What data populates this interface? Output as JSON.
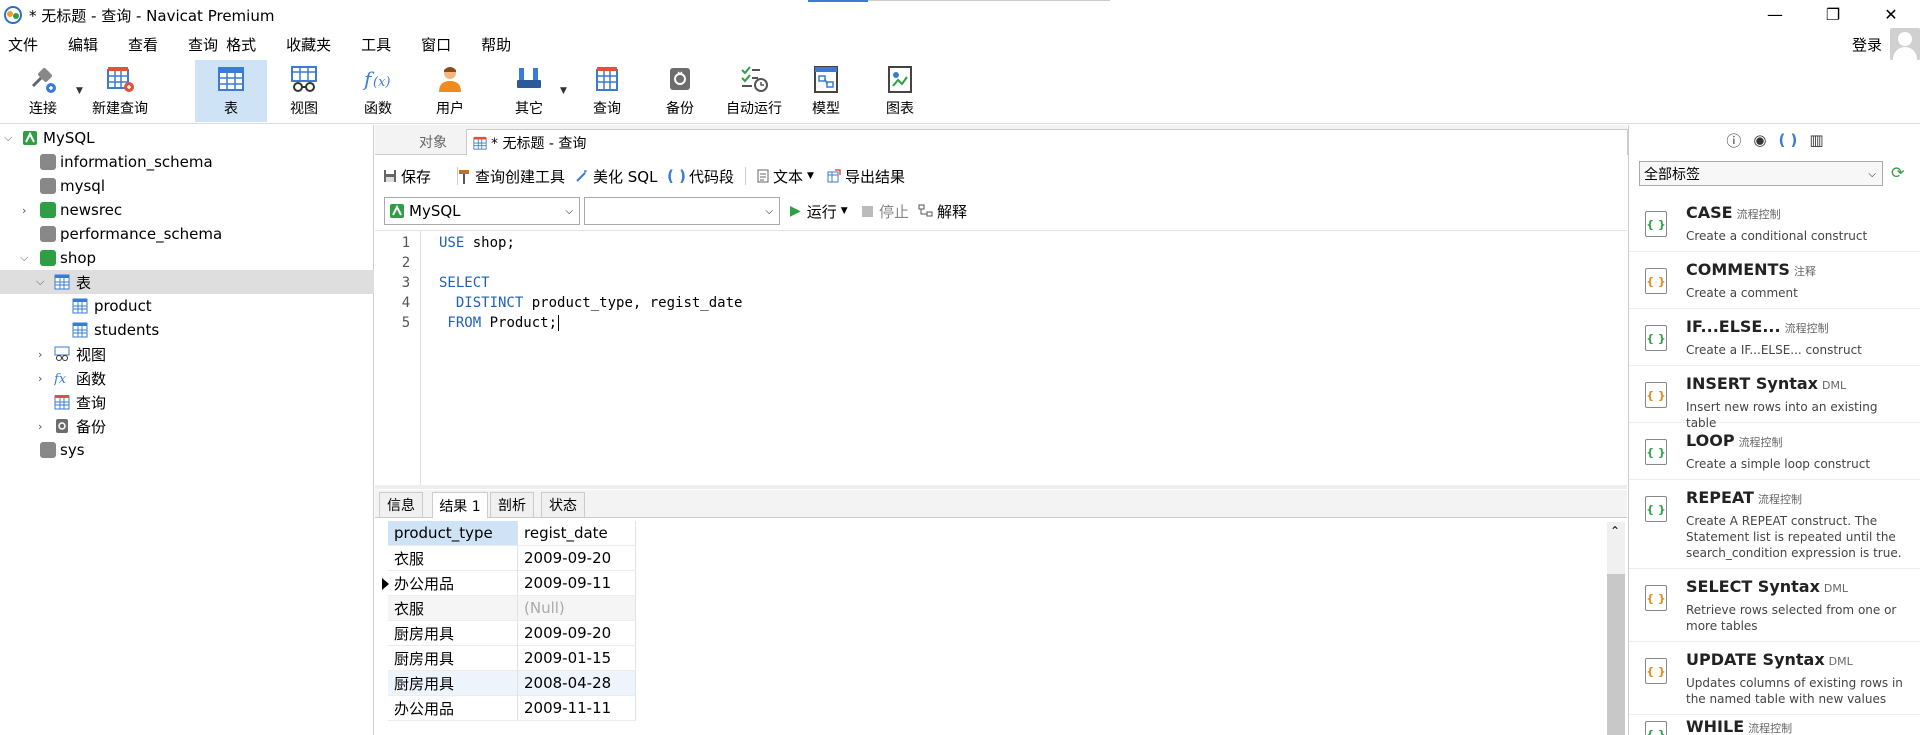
{
  "window": {
    "title": "* 无标题 - 查询 - Navicat Premium",
    "minimize": "—",
    "maximize": "❐",
    "close": "✕"
  },
  "menu": [
    "文件",
    "编辑",
    "查看",
    "查询",
    "格式",
    "收藏夹",
    "工具",
    "窗口",
    "帮助"
  ],
  "login": "登录",
  "toolbar": {
    "connect": "连接",
    "new_query": "新建查询",
    "table": "表",
    "view": "视图",
    "function": "函数",
    "user": "用户",
    "other": "其它",
    "query": "查询",
    "backup": "备份",
    "automation": "自动运行",
    "model": "模型",
    "chart": "图表"
  },
  "tree": {
    "root": "MySQL",
    "dbs": [
      "information_schema",
      "mysql",
      "newsrec",
      "performance_schema",
      "shop"
    ],
    "shop_children": {
      "tables": "表",
      "product": "product",
      "students": "students",
      "views": "视图",
      "functions": "函数",
      "queries": "查询",
      "backups": "备份"
    },
    "sys": "sys"
  },
  "tabs": {
    "objects": "对象",
    "query_tab": "* 无标题 - 查询"
  },
  "query_toolbar": {
    "save": "保存",
    "builder": "查询创建工具",
    "beautify": "美化 SQL",
    "snippet": "代码段",
    "text": "文本",
    "export": "导出结果"
  },
  "selectors": {
    "connection": "MySQL",
    "database": "",
    "run": "运行",
    "stop": "停止",
    "explain": "解释"
  },
  "editor": {
    "line_numbers": [
      "1",
      "2",
      "3",
      "4",
      "5"
    ],
    "lines": [
      {
        "kw": "USE",
        "rest": " shop;"
      },
      {
        "kw": "",
        "rest": ""
      },
      {
        "kw": "SELECT",
        "rest": ""
      },
      {
        "kw": "  DISTINCT",
        "rest": " product_type, regist_date"
      },
      {
        "kw": " FROM",
        "rest": " Product;"
      }
    ]
  },
  "result_tabs": [
    "信息",
    "结果 1",
    "剖析",
    "状态"
  ],
  "result": {
    "columns": [
      "product_type",
      "regist_date"
    ],
    "rows": [
      [
        "衣服",
        "2009-09-20"
      ],
      [
        "办公用品",
        "2009-09-11"
      ],
      [
        "衣服",
        "(Null)"
      ],
      [
        "厨房用具",
        "2009-09-20"
      ],
      [
        "厨房用具",
        "2009-01-15"
      ],
      [
        "厨房用具",
        "2008-04-28"
      ],
      [
        "办公用品",
        "2009-11-11"
      ]
    ]
  },
  "right_panel": {
    "header_icons": [
      "info-icon",
      "eye-icon",
      "braces-icon",
      "panel-icon"
    ],
    "header_glyphs": [
      "ⓘ",
      "◉",
      "( )",
      "▥"
    ],
    "tag_select": "全部标签",
    "snippets": [
      {
        "name": "CASE",
        "tag": "流程控制",
        "desc": "Create a conditional construct"
      },
      {
        "name": "COMMENTS",
        "tag": "注释",
        "desc": "Create a comment"
      },
      {
        "name": "IF...ELSE...",
        "tag": "流程控制",
        "desc": "Create a IF...ELSE... construct"
      },
      {
        "name": "INSERT Syntax",
        "tag": "DML",
        "desc": "Insert new rows into an existing table"
      },
      {
        "name": "LOOP",
        "tag": "流程控制",
        "desc": "Create a simple loop construct"
      },
      {
        "name": "REPEAT",
        "tag": "流程控制",
        "desc": "Create A REPEAT construct. The Statement list is repeated until the search_condition expression is true."
      },
      {
        "name": "SELECT Syntax",
        "tag": "DML",
        "desc": "Retrieve rows selected from one or more tables"
      },
      {
        "name": "UPDATE Syntax",
        "tag": "DML",
        "desc": "Updates columns of existing rows in the named table with new values"
      },
      {
        "name": "WHILE",
        "tag": "流程控制",
        "desc": ""
      }
    ]
  }
}
